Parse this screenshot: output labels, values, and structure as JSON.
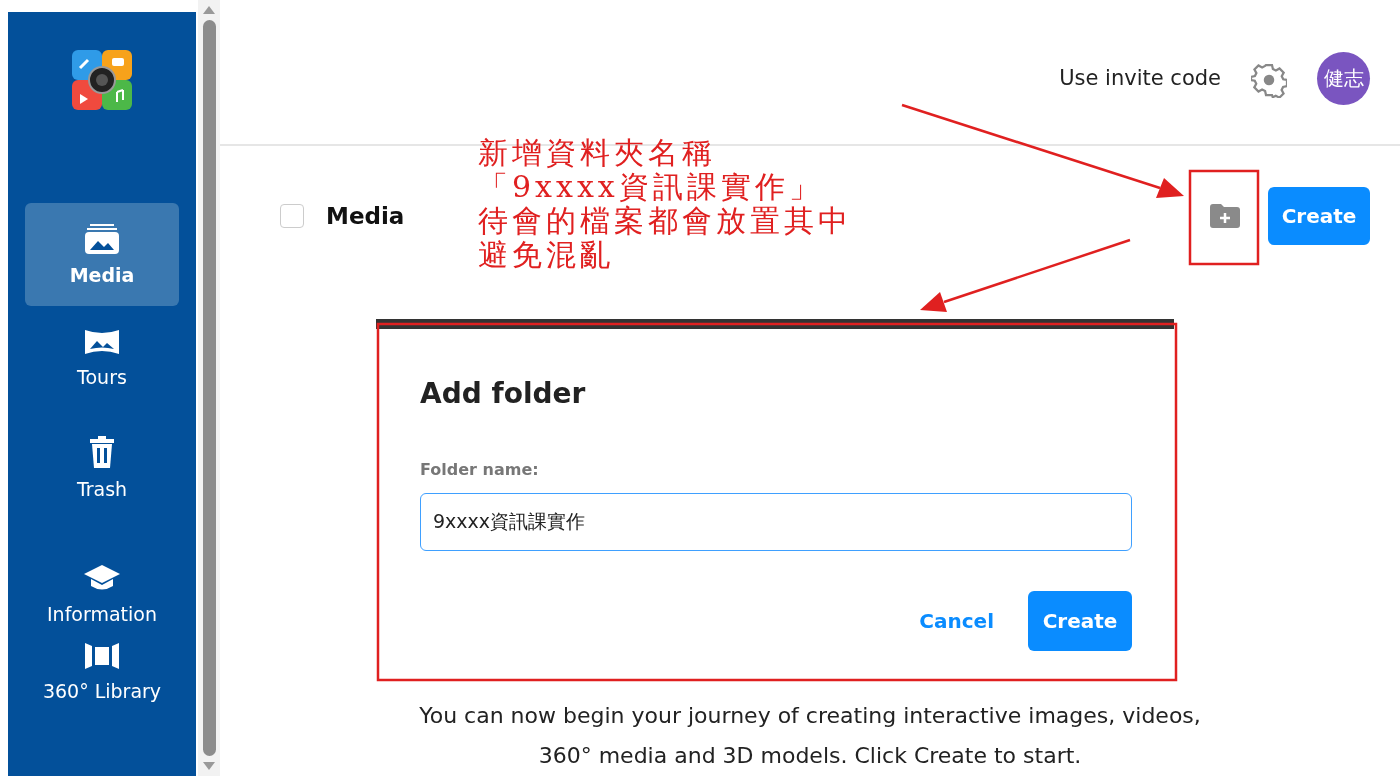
{
  "sidebar": {
    "items": [
      {
        "label": "Media",
        "selected": true
      },
      {
        "label": "Tours",
        "selected": false
      },
      {
        "label": "Trash",
        "selected": false
      },
      {
        "label": "Information",
        "selected": false
      },
      {
        "label": "360° Library",
        "selected": false
      }
    ]
  },
  "header": {
    "invite_link": "Use invite code",
    "avatar_initials": "健志"
  },
  "toolbar": {
    "title": "Media",
    "checked": false,
    "create_button": "Create"
  },
  "dialog": {
    "title": "Add folder",
    "field_label": "Folder name:",
    "value": "9xxxx資訊課實作",
    "buttons": [
      {
        "label": "Cancel",
        "kind": "link"
      },
      {
        "label": "Create",
        "kind": "primary"
      }
    ]
  },
  "empty_message": "You can now begin your journey of creating interactive images, videos, 360° media and 3D models. Click Create to start.",
  "annotation": {
    "lines": [
      "新增資料夾名稱",
      "「9xxxx資訊課實作」",
      "待會的檔案都會放置其中",
      "避免混亂"
    ]
  }
}
